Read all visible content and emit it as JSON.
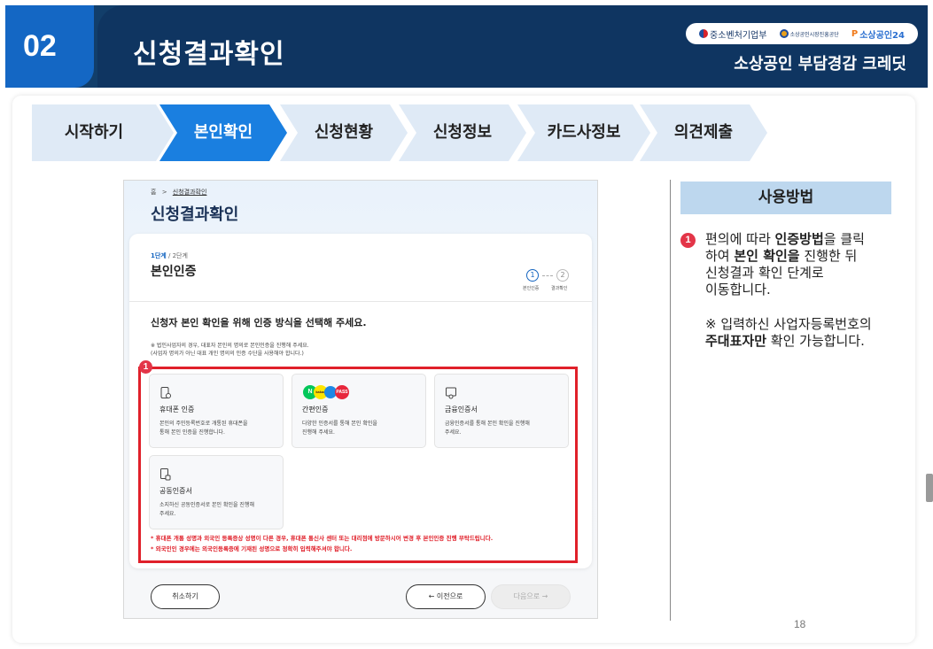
{
  "header": {
    "number": "02",
    "title": "신청결과확인",
    "subtitle": "소상공인 부담경감 크레딧",
    "logos": [
      "중소벤처기업부",
      "소상공인시장진흥공단",
      "소상공인24"
    ]
  },
  "steps": [
    {
      "label": "시작하기",
      "active": false
    },
    {
      "label": "본인확인",
      "active": true
    },
    {
      "label": "신청현황",
      "active": false
    },
    {
      "label": "신청정보",
      "active": false
    },
    {
      "label": "카드사정보",
      "active": false
    },
    {
      "label": "의견제출",
      "active": false
    }
  ],
  "screen": {
    "breadcrumb_home": "홈",
    "breadcrumb_sep": ">",
    "breadcrumb_current": "신청결과확인",
    "title": "신청결과확인",
    "stage_current": "1단계",
    "stage_total": "/ 2단계",
    "section_title": "본인인증",
    "stepper": [
      {
        "num": "1",
        "label": "본인인증"
      },
      {
        "num": "2",
        "label": "결과확인"
      }
    ],
    "question": "신청자 본인 확인을 위해 인증 방식을 선택해 주세요.",
    "note1": "※ 법인사업자의 경우, 대표자 본인의 명의로 본인인증을 진행해 주세요.",
    "note2": "(사업자 명의가 아닌 대표 개인 명의의 인증 수단을 사용해야 합니다.)",
    "options": [
      {
        "title": "휴대폰 인증",
        "desc1": "본인의 주민등록번호로 개통된 휴대폰을",
        "desc2": "통해 본인 인증을 진행합니다."
      },
      {
        "title": "간편인증",
        "desc1": "다양한 인증서를 통해 본인 확인을",
        "desc2": "진행해 주세요."
      },
      {
        "title": "금융인증서",
        "desc1": "금융인증서를 통해 본인 확인을 진행해",
        "desc2": "주세요."
      },
      {
        "title": "공동인증서",
        "desc1": "소지하신 공동인증서로 본인 확인을 진행해",
        "desc2": "주세요."
      }
    ],
    "pay_icons": [
      "N",
      "kakao",
      "",
      "PASS"
    ],
    "warning1": "* 휴대폰 개통 성명과 외국인 등록증상 성명이 다른 경우, 휴대폰 통신사 센터 또는 대리점에 방문하시어 변경 후 본인인증 진행 부탁드립니다.",
    "warning2": "* 외국인인 경우에는 외국인등록증에 기재된 성명으로 정확히 입력해주셔야 합니다.",
    "cancel_label": "취소하기",
    "prev_label": "← 이전으로",
    "next_label": "다음으로 →",
    "marker": "1"
  },
  "side": {
    "heading": "사용방법",
    "marker": "1",
    "line1_a": "편의에 따라 ",
    "line1_b": "인증방법",
    "line1_c": "을 클릭",
    "line2_a": "하여 ",
    "line2_b": "본인 확인을",
    "line2_c": " 진행한 뒤",
    "line3": "신청결과 확인 단계로",
    "line4": "이동합니다.",
    "note_a": "※ 입력하신 사업자등록번호의",
    "note_b": "주대표자만",
    "note_c": " 확인 가능합니다."
  },
  "page_number": "18",
  "colors": {
    "header_dark": "#0f3561",
    "header_number": "#1467c4",
    "step_active": "#1a7fe0",
    "step_inactive": "#dfeaf6",
    "highlight_red": "#e0202a",
    "marker_red": "#e33548",
    "howto_bg": "#bdd7ee"
  }
}
